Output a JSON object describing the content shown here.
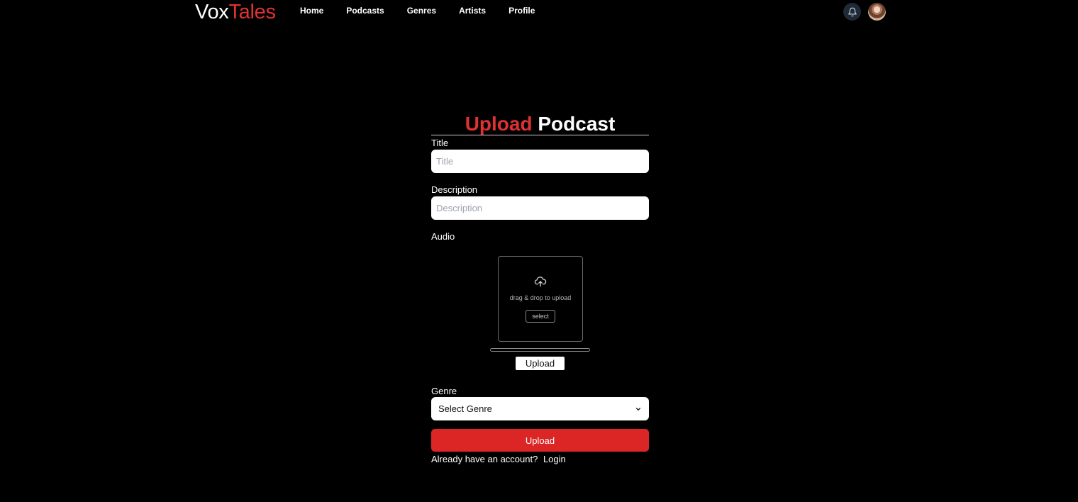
{
  "navbar": {
    "logo_part1": "Vox",
    "logo_part2": "Tales",
    "links": [
      "Home",
      "Podcasts",
      "Genres",
      "Artists",
      "Profile"
    ]
  },
  "form": {
    "heading_accent": "Upload",
    "heading_rest": "Podcast",
    "title_label": "Title",
    "title_placeholder": "Title",
    "description_label": "Description",
    "description_placeholder": "Description",
    "audio_label": "Audio",
    "dropzone_text": "drag & drop to upload",
    "dropzone_select": "select",
    "audio_upload_button": "Upload",
    "audio_progress": 0,
    "genre_label": "Genre",
    "genre_selected": "Select Genre",
    "submit_button": "Upload",
    "footer_text": "Already have an account?",
    "footer_link": "Login"
  },
  "icons": {
    "notification": "bell-icon",
    "upload": "cloud-upload-icon",
    "dropdown": "chevron-down-icon"
  },
  "colors": {
    "background": "#000000",
    "accent": "#e03131",
    "button_red": "#dc2626",
    "bell_bg": "#1f2937"
  }
}
